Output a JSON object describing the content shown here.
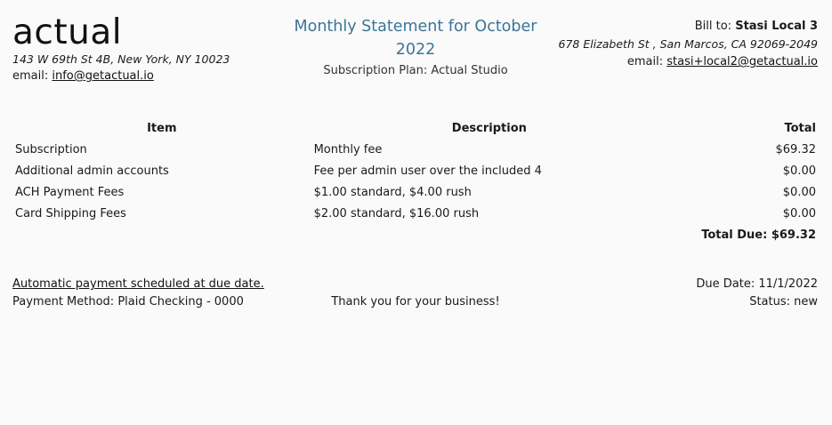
{
  "company": {
    "logo": "actual",
    "address": "143 W 69th St 4B, New York, NY 10023",
    "email_label": "email:",
    "email": "info@getactual.io"
  },
  "statement": {
    "title": "Monthly Statement for October 2022",
    "plan": "Subscription Plan: Actual Studio"
  },
  "bill_to": {
    "label": "Bill to:",
    "name": "Stasi Local 3",
    "address": "678 Elizabeth St , San Marcos, CA 92069-2049",
    "email_label": "email:",
    "email": "stasi+local2@getactual.io"
  },
  "table": {
    "headers": {
      "item": "Item",
      "description": "Description",
      "total": "Total"
    },
    "rows": [
      {
        "item": "Subscription",
        "description": "Monthly fee",
        "total": "$69.32"
      },
      {
        "item": "Additional admin accounts",
        "description": "Fee per admin user over the included 4",
        "total": "$0.00"
      },
      {
        "item": "ACH Payment Fees",
        "description": "$1.00 standard, $4.00 rush",
        "total": "$0.00"
      },
      {
        "item": "Card Shipping Fees",
        "description": "$2.00 standard, $16.00 rush",
        "total": "$0.00"
      }
    ],
    "total_due": "Total Due: $69.32"
  },
  "footer": {
    "autopay": "Automatic payment scheduled at due date.",
    "payment_method": "Payment Method: Plaid Checking - 0000",
    "thanks": "Thank you for your business!",
    "due_date": "Due Date: 11/1/2022",
    "status": "Status: new"
  },
  "colors": {
    "accent": "#3b7596",
    "background": "#fafafa",
    "text": "#1a1a1a"
  }
}
